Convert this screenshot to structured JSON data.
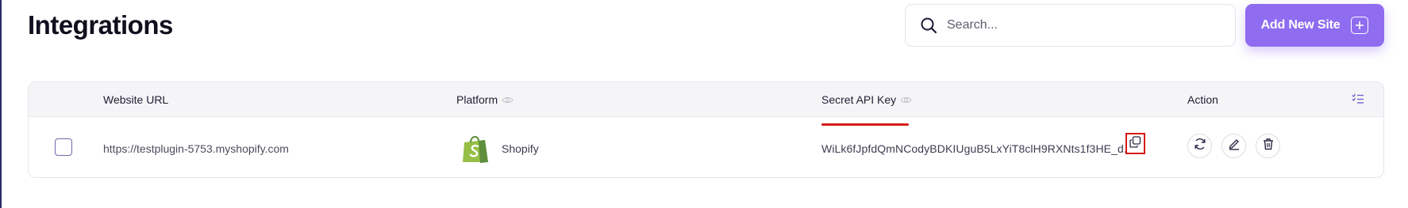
{
  "header": {
    "title": "Integrations",
    "search_placeholder": "Search...",
    "add_button_label": "Add New Site"
  },
  "table": {
    "columns": {
      "website_url": "Website URL",
      "platform": "Platform",
      "secret_api_key": "Secret API Key",
      "action": "Action"
    },
    "rows": [
      {
        "website_url": "https://testplugin-5753.myshopify.com",
        "platform": "Shopify",
        "secret_api_key": "WiLk6fJpfdQmNCodyBDKIUguB5LxYiT8clH9RXNts1f3HE_d..."
      }
    ]
  },
  "colors": {
    "accent": "#8f6cf0",
    "highlight_red": "#d51a1a",
    "shopify_green": "#95bf47",
    "header_bg": "#f5f5f7"
  },
  "icons": [
    "search-icon",
    "plus-icon",
    "eye-icon",
    "columns-icon",
    "shopify-logo",
    "copy-icon",
    "refresh-icon",
    "edit-icon",
    "trash-icon"
  ]
}
